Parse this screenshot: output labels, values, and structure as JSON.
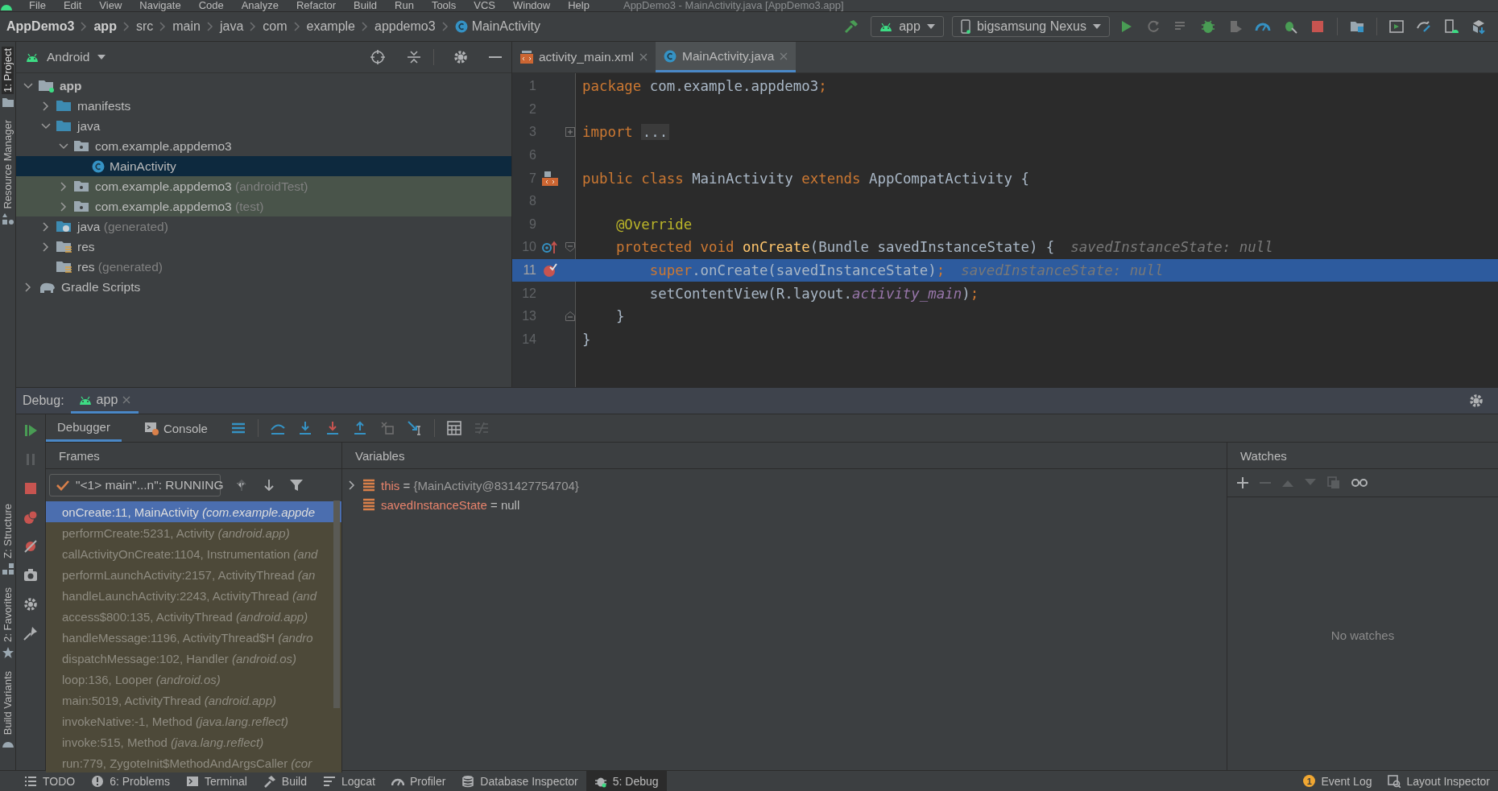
{
  "menu_bar": {
    "items": [
      "File",
      "Edit",
      "View",
      "Navigate",
      "Code",
      "Analyze",
      "Refactor",
      "Build",
      "Run",
      "Tools",
      "VCS",
      "Window",
      "Help"
    ],
    "title": "AppDemo3 - MainActivity.java [AppDemo3.app]"
  },
  "breadcrumb": [
    {
      "label": "AppDemo3",
      "kind": "project"
    },
    {
      "label": "app",
      "kind": "module"
    },
    {
      "label": "src",
      "kind": "dir"
    },
    {
      "label": "main",
      "kind": "dir"
    },
    {
      "label": "java",
      "kind": "dir"
    },
    {
      "label": "com",
      "kind": "dir"
    },
    {
      "label": "example",
      "kind": "dir"
    },
    {
      "label": "appdemo3",
      "kind": "dir"
    },
    {
      "label": "MainActivity",
      "kind": "class"
    }
  ],
  "run_toolbar": {
    "configuration": "app",
    "device": "bigsamsung Nexus"
  },
  "left_stripe": {
    "top": [
      {
        "label": "1: Project",
        "selected": true
      },
      {
        "label": "Resource Manager",
        "selected": false
      }
    ],
    "bottom": [
      {
        "label": "Z: Structure",
        "selected": false
      },
      {
        "label": "2: Favorites",
        "selected": false
      },
      {
        "label": "Build Variants",
        "selected": false
      }
    ]
  },
  "project": {
    "view": "Android",
    "tree": [
      {
        "label": "app",
        "kind": "module",
        "expanded": true,
        "selected": false,
        "children": [
          {
            "label": "manifests",
            "kind": "folder",
            "expanded": false,
            "selected": false
          },
          {
            "label": "java",
            "kind": "folder",
            "expanded": true,
            "selected": false,
            "children": [
              {
                "label": "com.example.appdemo3",
                "kind": "package",
                "expanded": true,
                "selected": false,
                "test_scope": false,
                "children": [
                  {
                    "label": "MainActivity",
                    "kind": "class",
                    "selected": true
                  }
                ]
              },
              {
                "label": "com.example.appdemo3",
                "suffix": "(androidTest)",
                "kind": "package",
                "expanded": false,
                "selected": false,
                "test_scope": true
              },
              {
                "label": "com.example.appdemo3",
                "suffix": "(test)",
                "kind": "package",
                "expanded": false,
                "selected": false,
                "test_scope": true
              }
            ]
          },
          {
            "label": "java",
            "suffix": "(generated)",
            "kind": "generated",
            "expanded": false,
            "selected": false
          },
          {
            "label": "res",
            "kind": "res",
            "expanded": false,
            "selected": false
          },
          {
            "label": "res",
            "suffix": "(generated)",
            "kind": "res",
            "selected": false
          }
        ]
      },
      {
        "label": "Gradle Scripts",
        "kind": "gradle",
        "expanded": false,
        "selected": false
      }
    ]
  },
  "editor": {
    "tabs": [
      {
        "label": "activity_main.xml",
        "kind": "xml",
        "selected": false
      },
      {
        "label": "MainActivity.java",
        "kind": "class",
        "selected": true
      }
    ],
    "lines": [
      {
        "number": "1",
        "current": false,
        "tokens": [
          {
            "kind": "keyword",
            "text": "package "
          },
          {
            "kind": "plain",
            "text": "com.example.appdemo3"
          },
          {
            "kind": "keyword",
            "text": ";"
          }
        ]
      },
      {
        "number": "2",
        "current": false
      },
      {
        "number": "3",
        "current": false,
        "collapsed": true,
        "tokens": [
          {
            "kind": "keyword",
            "text": "import"
          }
        ],
        "folded": "..."
      },
      {
        "number": "6",
        "current": false
      },
      {
        "number": "7",
        "current": false,
        "layout_link": true,
        "tokens": [
          {
            "kind": "keyword",
            "text": "public class "
          },
          {
            "kind": "plain",
            "text": "MainActivity "
          },
          {
            "kind": "keyword",
            "text": "extends "
          },
          {
            "kind": "plain",
            "text": "AppCompatActivity {"
          }
        ]
      },
      {
        "number": "8",
        "current": false
      },
      {
        "number": "9",
        "current": false,
        "tokens": [
          {
            "kind": "annotation",
            "text": "    @Override"
          }
        ]
      },
      {
        "number": "10",
        "current": false,
        "overrides": true,
        "fold_start": true,
        "tokens": [
          {
            "kind": "keyword",
            "text": "    protected void "
          },
          {
            "kind": "method",
            "text": "onCreate"
          },
          {
            "kind": "plain",
            "text": "(Bundle savedInstanceState) {"
          }
        ],
        "hint": "savedInstanceState: null"
      },
      {
        "number": "11",
        "current": true,
        "breakpoint": true,
        "tokens": [
          {
            "kind": "keyword",
            "text": "        super"
          },
          {
            "kind": "plain",
            "text": ".onCreate(savedInstanceState)"
          },
          {
            "kind": "keyword",
            "text": ";"
          }
        ],
        "hint": "savedInstanceState: null"
      },
      {
        "number": "12",
        "current": false,
        "tokens": [
          {
            "kind": "plain",
            "text": "        setContentView(R.layout."
          },
          {
            "kind": "field",
            "text": "activity_main"
          },
          {
            "kind": "plain",
            "text": ")"
          },
          {
            "kind": "keyword",
            "text": ";"
          }
        ]
      },
      {
        "number": "13",
        "current": false,
        "fold_end": true,
        "tokens": [
          {
            "kind": "plain",
            "text": "    }"
          }
        ]
      },
      {
        "number": "14",
        "current": false,
        "tokens": [
          {
            "kind": "plain",
            "text": "}"
          }
        ]
      }
    ]
  },
  "debug": {
    "label": "Debug:",
    "session": "app",
    "tabs": [
      {
        "label": "Debugger",
        "selected": true
      },
      {
        "label": "Console",
        "selected": false
      }
    ],
    "frames_title": "Frames",
    "thread": "\"<1> main\"...n\": RUNNING",
    "frames": [
      {
        "method": "onCreate:11, MainActivity",
        "package": "(com.example.appde",
        "selected": true
      },
      {
        "method": "performCreate:5231, Activity",
        "package": "(android.app)",
        "selected": false
      },
      {
        "method": "callActivityOnCreate:1104, Instrumentation",
        "package": "(and",
        "selected": false
      },
      {
        "method": "performLaunchActivity:2157, ActivityThread",
        "package": "(an",
        "selected": false
      },
      {
        "method": "handleLaunchActivity:2243, ActivityThread",
        "package": "(and",
        "selected": false
      },
      {
        "method": "access$800:135, ActivityThread",
        "package": "(android.app)",
        "selected": false
      },
      {
        "method": "handleMessage:1196, ActivityThread$H",
        "package": "(andro",
        "selected": false
      },
      {
        "method": "dispatchMessage:102, Handler",
        "package": "(android.os)",
        "selected": false
      },
      {
        "method": "loop:136, Looper",
        "package": "(android.os)",
        "selected": false
      },
      {
        "method": "main:5019, ActivityThread",
        "package": "(android.app)",
        "selected": false
      },
      {
        "method": "invokeNative:-1, Method",
        "package": "(java.lang.reflect)",
        "selected": false
      },
      {
        "method": "invoke:515, Method",
        "package": "(java.lang.reflect)",
        "selected": false
      },
      {
        "method": "run:779, ZygoteInit$MethodAndArgsCaller",
        "package": "(cor",
        "selected": false
      }
    ],
    "variables_title": "Variables",
    "variables": [
      {
        "name": "this",
        "operator": "=",
        "value": "{MainActivity@831427754704}",
        "expandable": true
      },
      {
        "name": "savedInstanceState",
        "operator": "=",
        "value": "null",
        "expandable": false
      }
    ],
    "watches_title": "Watches",
    "watches_empty": "No watches"
  },
  "status_bar": {
    "left": [
      {
        "label": "TODO",
        "kind": "list",
        "selected": false
      },
      {
        "label": "6: Problems",
        "kind": "problems",
        "selected": false
      },
      {
        "label": "Terminal",
        "kind": "terminal",
        "selected": false
      },
      {
        "label": "Build",
        "kind": "hammer",
        "selected": false
      },
      {
        "label": "Logcat",
        "kind": "log",
        "selected": false
      },
      {
        "label": "Profiler",
        "kind": "gauge",
        "selected": false
      },
      {
        "label": "Database Inspector",
        "kind": "database",
        "selected": false
      },
      {
        "label": "5: Debug",
        "kind": "bug",
        "selected": true
      }
    ],
    "right": [
      {
        "label": "Event Log",
        "kind": "event",
        "badge": "1",
        "selected": false
      },
      {
        "label": "Layout Inspector",
        "kind": "layout",
        "selected": false
      }
    ]
  }
}
